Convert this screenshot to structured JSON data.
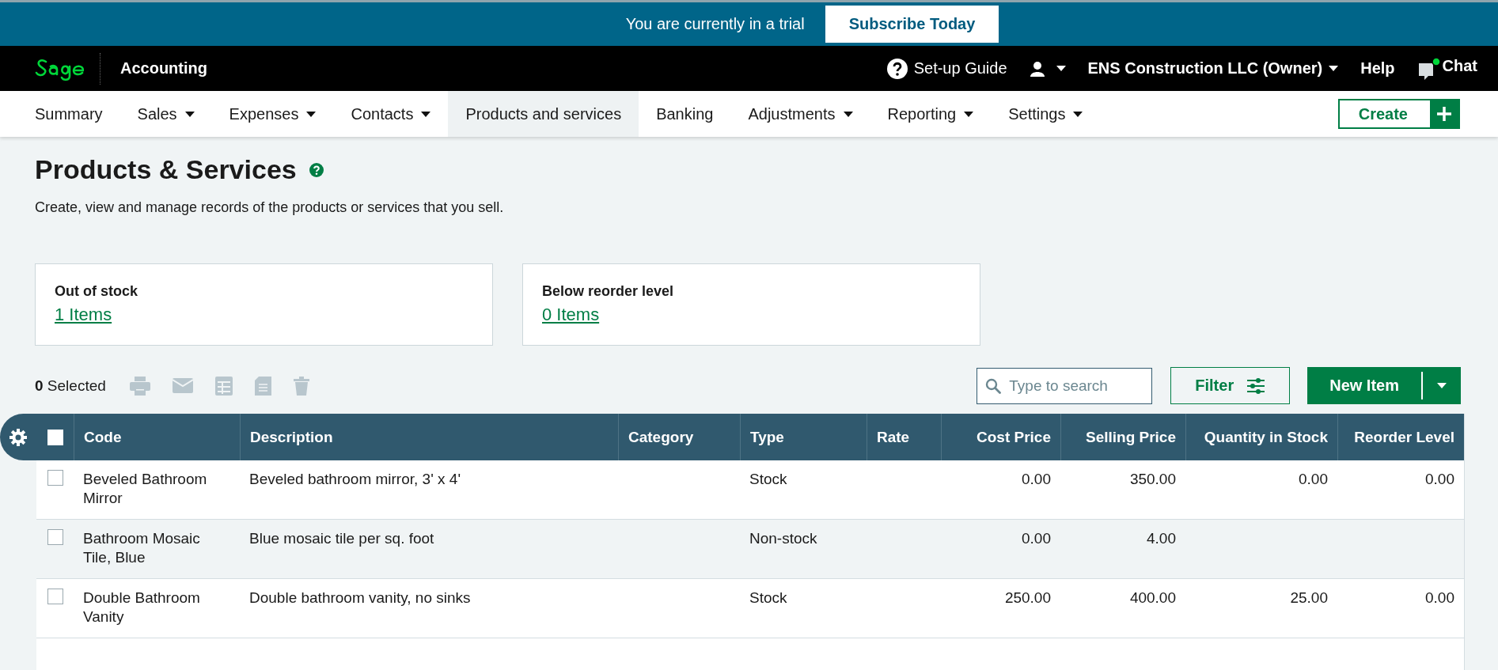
{
  "trial_banner": {
    "text": "You are currently in a trial",
    "button": "Subscribe Today"
  },
  "header": {
    "product": "Accounting",
    "setup_guide": "Set-up Guide",
    "account": "ENS Construction LLC (Owner)",
    "help": "Help",
    "chat": "Chat",
    "chat_online": true
  },
  "nav": {
    "items": [
      {
        "label": "Summary",
        "has_menu": false,
        "selected": false
      },
      {
        "label": "Sales",
        "has_menu": true,
        "selected": false
      },
      {
        "label": "Expenses",
        "has_menu": true,
        "selected": false
      },
      {
        "label": "Contacts",
        "has_menu": true,
        "selected": false
      },
      {
        "label": "Products and services",
        "has_menu": false,
        "selected": true
      },
      {
        "label": "Banking",
        "has_menu": false,
        "selected": false
      },
      {
        "label": "Adjustments",
        "has_menu": true,
        "selected": false
      },
      {
        "label": "Reporting",
        "has_menu": true,
        "selected": false
      },
      {
        "label": "Settings",
        "has_menu": true,
        "selected": false
      }
    ],
    "create_button": "Create"
  },
  "page": {
    "title": "Products & Services",
    "subtitle": "Create, view and manage records of the products or services that you sell."
  },
  "stock_cards": [
    {
      "label": "Out of stock",
      "link": "1 Items"
    },
    {
      "label": "Below reorder level",
      "link": "0 Items"
    }
  ],
  "toolbar": {
    "selected": "**0** Selected",
    "search": {
      "placeholder": "Type to search"
    },
    "filter_button": "Filter",
    "new_item_button": "New Item"
  },
  "table": {
    "all_checked": false,
    "columns": [
      {
        "label": "Code",
        "kind": "text"
      },
      {
        "label": "Description",
        "kind": "text"
      },
      {
        "label": "Category",
        "kind": "text"
      },
      {
        "label": "Type",
        "kind": "text"
      },
      {
        "label": "Rate",
        "kind": "text"
      },
      {
        "label": "Cost Price",
        "kind": "number"
      },
      {
        "label": "Selling Price",
        "kind": "number"
      },
      {
        "label": "Quantity in Stock",
        "kind": "number"
      },
      {
        "label": "Reorder Level",
        "kind": "number"
      }
    ],
    "rows": [
      {
        "checked": false,
        "cells": [
          "Beveled Bathroom Mirror",
          "Beveled bathroom mirror, 3' x 4'",
          null,
          "Stock",
          null,
          "0.00",
          "350.00",
          "0.00",
          "0.00"
        ]
      },
      {
        "checked": false,
        "cells": [
          "Bathroom Mosaic Tile, Blue",
          "Blue mosaic tile per sq. foot",
          null,
          "Non-stock",
          null,
          "0.00",
          "4.00",
          null,
          null
        ]
      },
      {
        "checked": false,
        "cells": [
          "Double Bathroom Vanity",
          "Double bathroom vanity, no sinks",
          null,
          "Stock",
          null,
          "250.00",
          "400.00",
          "25.00",
          "0.00"
        ]
      }
    ]
  }
}
